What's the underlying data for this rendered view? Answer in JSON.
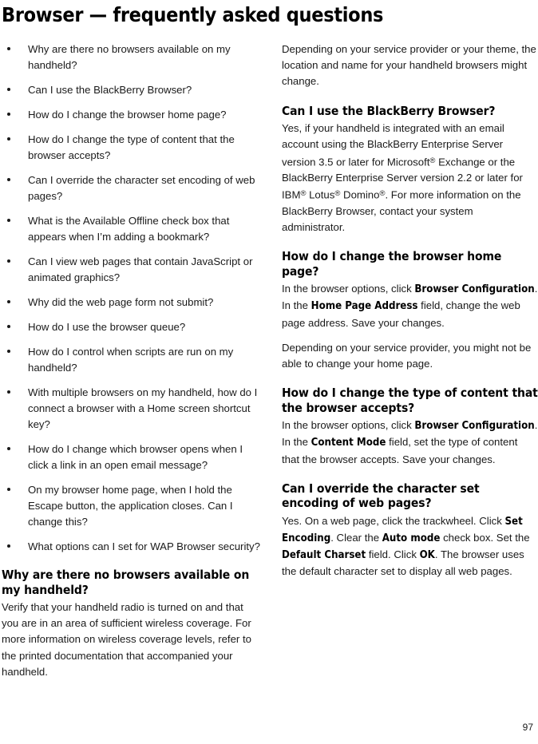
{
  "document": {
    "title": "Browser — frequently asked questions",
    "page_number": "97"
  },
  "left_column": {
    "faq_links": [
      "Why are there no browsers available on my handheld?",
      "Can I use the BlackBerry Browser?",
      "How do I change the browser home page?",
      "How do I change the type of content that the browser accepts?",
      "Can I override the character set encoding of web pages?",
      "What is the Available Offline check box that appears when I’m adding a bookmark?",
      "Can I view web pages that contain JavaScript or animated graphics?",
      "Why did the web page form not submit?",
      "How do I use the browser queue?",
      "How do I control when scripts are run on my handheld?",
      "With multiple browsers on my handheld, how do I connect a browser with a Home screen shortcut key?",
      "How do I change which browser opens when I click a link in an open email message?",
      "On my browser home page, when I hold the Escape button, the application closes. Can I change this?",
      "What options can I set for WAP Browser security?"
    ],
    "section": {
      "heading": "Why are there no browsers available on my handheld?",
      "paragraph": "Verify that your handheld radio is turned on and that you are in an area of sufficient wireless coverage. For more information on wireless coverage levels, refer to the printed documentation that accompanied your handheld."
    }
  },
  "right_column": {
    "intro_paragraph": "Depending on your service provider or your theme, the location and name for your handheld browsers might change.",
    "sections": [
      {
        "heading": "Can I use the BlackBerry Browser?",
        "paragraph_parts": [
          {
            "type": "text",
            "value": "Yes, if your handheld is integrated with an email account using the BlackBerry Enterprise Server version 3.5 or later for Microsoft"
          },
          {
            "type": "reg",
            "value": "®"
          },
          {
            "type": "text",
            "value": " Exchange or the BlackBerry Enterprise Server version 2.2 or later for IBM"
          },
          {
            "type": "reg",
            "value": "®"
          },
          {
            "type": "text",
            "value": " Lotus"
          },
          {
            "type": "reg",
            "value": "®"
          },
          {
            "type": "text",
            "value": " Domino"
          },
          {
            "type": "reg",
            "value": "®"
          },
          {
            "type": "text",
            "value": ". For more information on the BlackBerry Browser, contact your system administrator."
          }
        ]
      },
      {
        "heading": "How do I change the browser home page?",
        "paragraph_parts": [
          {
            "type": "text",
            "value": "In the browser options, click "
          },
          {
            "type": "bold",
            "value": "Browser Configuration"
          },
          {
            "type": "text",
            "value": ". In the "
          },
          {
            "type": "bold",
            "value": "Home Page Address"
          },
          {
            "type": "text",
            "value": " field, change the web page address. Save your changes."
          }
        ],
        "extra_paragraph": "Depending on your service provider, you might not be able to change your home page."
      },
      {
        "heading": "How do I change the type of content that the browser accepts?",
        "paragraph_parts": [
          {
            "type": "text",
            "value": "In the browser options, click "
          },
          {
            "type": "bold",
            "value": "Browser Configuration"
          },
          {
            "type": "text",
            "value": ". In the "
          },
          {
            "type": "bold",
            "value": "Content Mode"
          },
          {
            "type": "text",
            "value": " field, set the type of content that the browser accepts. Save your changes."
          }
        ]
      },
      {
        "heading": "Can I override the character set encoding of web pages?",
        "paragraph_parts": [
          {
            "type": "text",
            "value": "Yes. On a web page, click the trackwheel. Click "
          },
          {
            "type": "bold",
            "value": "Set Encoding"
          },
          {
            "type": "text",
            "value": ". Clear the "
          },
          {
            "type": "bold",
            "value": "Auto mode"
          },
          {
            "type": "text",
            "value": " check box. Set the "
          },
          {
            "type": "bold",
            "value": "Default Charset"
          },
          {
            "type": "text",
            "value": " field. Click "
          },
          {
            "type": "bold",
            "value": "OK"
          },
          {
            "type": "text",
            "value": ". The browser uses the default character set to display all web pages."
          }
        ]
      }
    ]
  }
}
